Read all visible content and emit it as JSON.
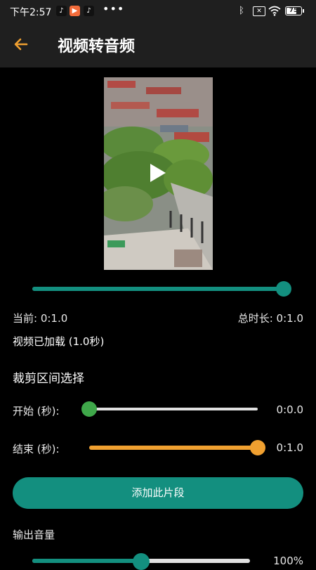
{
  "status_bar": {
    "time": "下午2:57",
    "battery": "75",
    "battery_level": 0.75,
    "icons": [
      "tiktok-icon",
      "video-app-icon",
      "tiktok-icon",
      "more-dots-icon",
      "bluetooth-icon",
      "sim-off-icon",
      "wifi-icon",
      "battery-icon"
    ]
  },
  "header": {
    "title": "视频转音频",
    "back_icon": "arrow-left-icon"
  },
  "player": {
    "play_icon": "play-icon",
    "progress": 1.0,
    "current_label": "当前: 0:1.0",
    "total_label": "总时长: 0:1.0",
    "loaded_text": "视频已加载 (1.0秒)"
  },
  "trim": {
    "section_title": "裁剪区间选择",
    "start_label": "开始 (秒):",
    "start_value": "0:0.0",
    "start_fraction": 0.0,
    "end_label": "结束 (秒):",
    "end_value": "0:1.0",
    "end_fraction": 1.0
  },
  "actions": {
    "add_segment": "添加此片段"
  },
  "volume": {
    "label": "输出音量",
    "value": "100%",
    "fraction": 0.5
  },
  "colors": {
    "teal": "#138f7f",
    "orange": "#f0a030",
    "green": "#3fa84a"
  }
}
